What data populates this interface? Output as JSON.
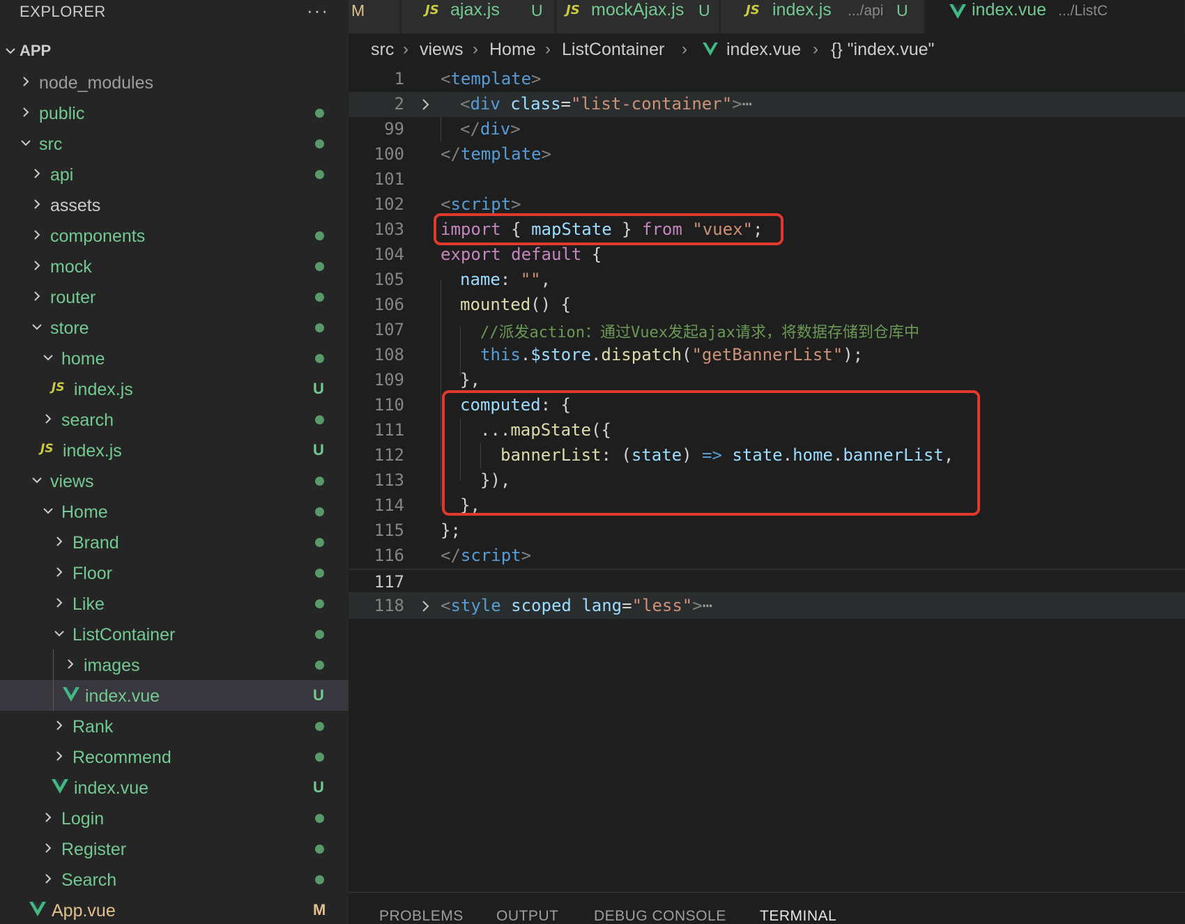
{
  "explorer": {
    "title": "EXPLORER",
    "more_label": "···",
    "root_label": "APP",
    "items": [
      {
        "label": "node_modules",
        "badge": "",
        "color": "#9d9d9d"
      },
      {
        "label": "public",
        "badge": "",
        "color": "#73c991"
      },
      {
        "label": "src",
        "badge": "",
        "color": "#73c991"
      },
      {
        "label": "api",
        "badge": "",
        "color": "#73c991"
      },
      {
        "label": "assets",
        "badge": "",
        "color": "#cccccc"
      },
      {
        "label": "components",
        "badge": "",
        "color": "#73c991"
      },
      {
        "label": "mock",
        "badge": "",
        "color": "#73c991"
      },
      {
        "label": "router",
        "badge": "",
        "color": "#73c991"
      },
      {
        "label": "store",
        "badge": "",
        "color": "#73c991"
      },
      {
        "label": "home",
        "badge": "",
        "color": "#73c991"
      },
      {
        "label": "index.js",
        "badge": "U",
        "color": "#73c991",
        "icon": "JS"
      },
      {
        "label": "search",
        "badge": "",
        "color": "#73c991"
      },
      {
        "label": "index.js",
        "badge": "U",
        "color": "#73c991",
        "icon": "JS"
      },
      {
        "label": "views",
        "badge": "",
        "color": "#73c991"
      },
      {
        "label": "Home",
        "badge": "",
        "color": "#73c991"
      },
      {
        "label": "Brand",
        "badge": "",
        "color": "#73c991"
      },
      {
        "label": "Floor",
        "badge": "",
        "color": "#73c991"
      },
      {
        "label": "Like",
        "badge": "",
        "color": "#73c991"
      },
      {
        "label": "ListContainer",
        "badge": "",
        "color": "#73c991"
      },
      {
        "label": "images",
        "badge": "",
        "color": "#73c991"
      },
      {
        "label": "index.vue",
        "badge": "U",
        "color": "#73c991",
        "icon": "vue"
      },
      {
        "label": "Rank",
        "badge": "",
        "color": "#73c991"
      },
      {
        "label": "Recommend",
        "badge": "",
        "color": "#73c991"
      },
      {
        "label": "index.vue",
        "badge": "U",
        "color": "#73c991",
        "icon": "vue"
      },
      {
        "label": "Login",
        "badge": "",
        "color": "#73c991"
      },
      {
        "label": "Register",
        "badge": "",
        "color": "#73c991"
      },
      {
        "label": "Search",
        "badge": "",
        "color": "#73c991"
      },
      {
        "label": "App.vue",
        "badge": "M",
        "color": "#e2c08d",
        "icon": "vue"
      }
    ]
  },
  "tabs": [
    {
      "name": "",
      "path": "",
      "badge": "M",
      "icon": ""
    },
    {
      "name": "ajax.js",
      "path": "",
      "badge": "U",
      "icon": "JS"
    },
    {
      "name": "mockAjax.js",
      "path": "",
      "badge": "U",
      "icon": "JS"
    },
    {
      "name": "index.js",
      "path": ".../api",
      "badge": "U",
      "icon": "JS"
    },
    {
      "name": "index.vue",
      "path": ".../ListC",
      "badge": "",
      "icon": "vue"
    }
  ],
  "breadcrumb": [
    "src",
    "views",
    "Home",
    "ListContainer",
    "index.vue",
    "{} \"index.vue\""
  ],
  "editor": {
    "line_numbers": [
      "1",
      "2",
      "99",
      "100",
      "101",
      "102",
      "103",
      "104",
      "105",
      "106",
      "107",
      "108",
      "109",
      "110",
      "111",
      "112",
      "113",
      "114",
      "115",
      "116",
      "117",
      "118"
    ],
    "tokens": {
      "template": "template",
      "div": "div",
      "class_attr": "class",
      "list_container": "\"list-container\"",
      "script": "script",
      "import_kw": "import",
      "mapState": "mapState",
      "from_kw": "from",
      "vuex": "\"vuex\"",
      "export_kw": "export",
      "default_kw": "default",
      "name_key": "name",
      "empty_str": "\"\"",
      "mounted": "mounted",
      "comment": "//派发action：通过Vuex发起ajax请求，将数据存储到仓库中",
      "this_kw": "this",
      "store": "$store",
      "dispatch": "dispatch",
      "getBannerList": "\"getBannerList\"",
      "computed": "computed",
      "spread": "...",
      "bannerList": "bannerList",
      "state": "state",
      "arrow": "=>",
      "home": "home",
      "style": "style",
      "scoped": "scoped",
      "lang": "lang",
      "less": "\"less\""
    }
  },
  "panel": {
    "tabs": [
      "PROBLEMS",
      "OUTPUT",
      "DEBUG CONSOLE",
      "TERMINAL"
    ]
  },
  "colors": {
    "git_untracked": "#73c991",
    "git_modified": "#e2c08d",
    "annotation": "#e0392b",
    "vue_green": "#42b883"
  }
}
